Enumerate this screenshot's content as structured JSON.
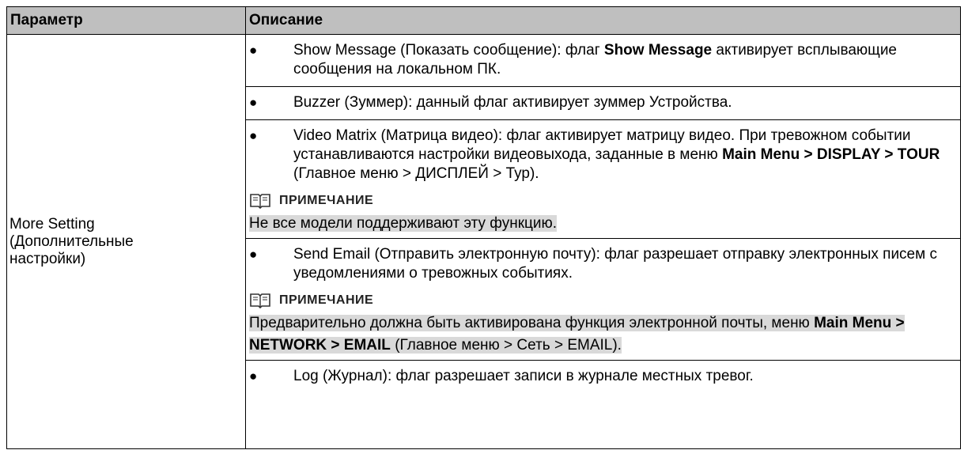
{
  "header": {
    "col_param": "Параметр",
    "col_desc": "Описание"
  },
  "row": {
    "param_line1": "More Setting",
    "param_line2": "(Дополнительные",
    "param_line3": "настройки)"
  },
  "items": {
    "show_message": {
      "pre": "Show Message (Показать сообщение): флаг ",
      "bold": "Show Message",
      "post": " активирует всплывающие сообщения на локальном ПК."
    },
    "buzzer": {
      "text": "Buzzer (Зуммер): данный флаг активирует зуммер Устройства."
    },
    "video_matrix": {
      "pre": "Video Matrix (Матрица видео): флаг активирует матрицу видео. При тревожном событии устанавливаются настройки видеовыхода, заданные в меню ",
      "bold": "Main Menu > DISPLAY > TOUR",
      "post": " (Главное меню > ДИСПЛЕЙ > Тур)."
    },
    "note1": {
      "title": "ПРИМЕЧАНИЕ",
      "text": "Не все модели поддерживают эту функцию."
    },
    "send_email": {
      "text": "Send Email (Отправить электронную почту): флаг разрешает отправку электронных писем с уведомлениями о тревожных событиях."
    },
    "note2": {
      "title": "ПРИМЕЧАНИЕ",
      "pre": "Предварительно должна быть активирована функция электронной почты, меню ",
      "bold": "Main Menu > NETWORK > EMAIL",
      "post": " (Главное меню > Сеть > EMAIL)."
    },
    "log": {
      "text": "Log (Журнал): флаг разрешает записи в журнале местных тревог."
    }
  },
  "icons": {
    "bullet": "bullet-dot",
    "note": "book-icon"
  },
  "colors": {
    "header_bg": "#bfbfbf",
    "note_highlight": "#d9d9d9"
  }
}
